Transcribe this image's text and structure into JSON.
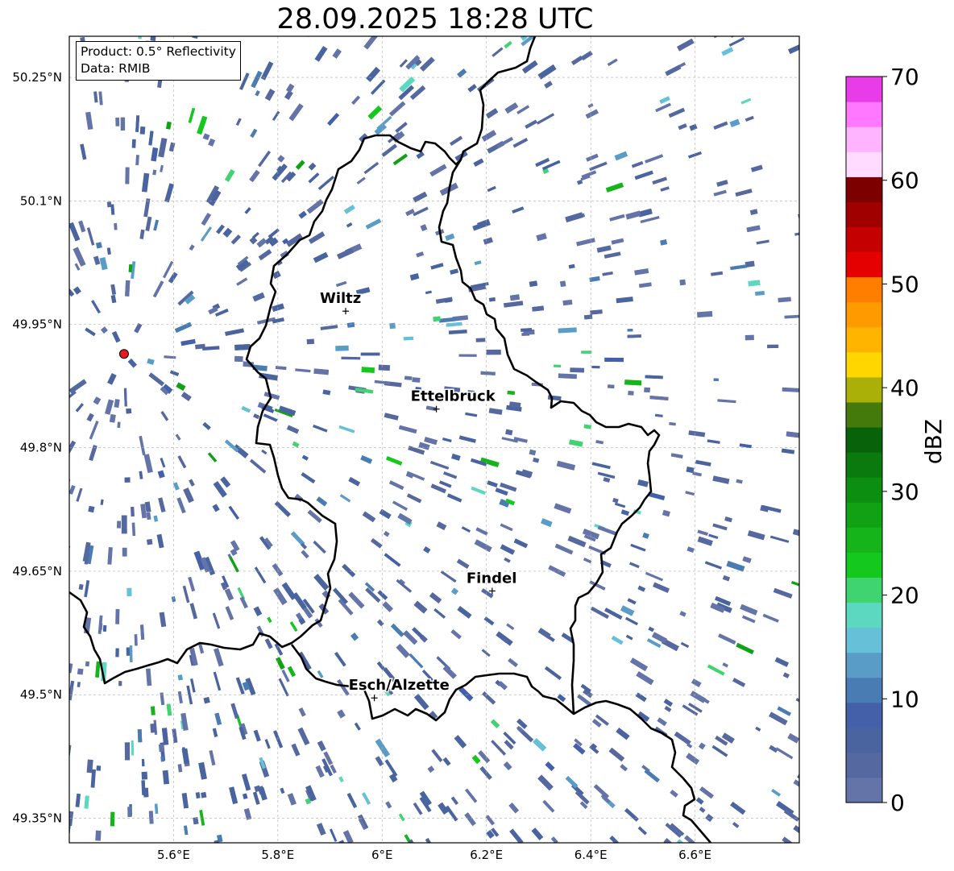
{
  "title": "28.09.2025 18:28 UTC",
  "info": {
    "product": "Product: 0.5° Reflectivity",
    "data": "Data: RMIB"
  },
  "axes": {
    "lon_range": [
      5.4,
      6.8
    ],
    "lat_range": [
      49.32,
      50.3
    ],
    "lon_ticks": [
      "5.6°E",
      "5.8°E",
      "6°E",
      "6.2°E",
      "6.4°E",
      "6.6°E"
    ],
    "lon_tick_values": [
      5.6,
      5.8,
      6.0,
      6.2,
      6.4,
      6.6
    ],
    "lat_ticks": [
      "50.25°N",
      "50.1°N",
      "49.95°N",
      "49.8°N",
      "49.65°N",
      "49.5°N",
      "49.35°N"
    ],
    "lat_tick_values": [
      50.25,
      50.1,
      49.95,
      49.8,
      49.65,
      49.5,
      49.35
    ],
    "grid": true
  },
  "radar_site": {
    "lon": 5.505,
    "lat": 49.914,
    "color": "#e41a1c"
  },
  "cities": [
    {
      "name": "Wiltz",
      "lon": 5.93,
      "lat": 49.966
    },
    {
      "name": "Ettelbruck",
      "lon": 6.104,
      "lat": 49.847
    },
    {
      "name": "Findel",
      "lon": 6.211,
      "lat": 49.626
    },
    {
      "name": "Esch/Alzette",
      "lon": 5.985,
      "lat": 49.496
    }
  ],
  "colorbar": {
    "label": "dBZ",
    "min": 0,
    "max": 70,
    "ticks": [
      "0",
      "10",
      "20",
      "30",
      "40",
      "50",
      "60",
      "70"
    ],
    "tick_values": [
      0,
      10,
      20,
      30,
      40,
      50,
      60,
      70
    ],
    "colors": [
      "#6474a8",
      "#5568a0",
      "#4a64a0",
      "#4460a8",
      "#4a7cb4",
      "#5a9cc8",
      "#66c0d8",
      "#5cd8c0",
      "#40d470",
      "#14c81e",
      "#14b41a",
      "#10a214",
      "#0c8e10",
      "#0a7a0e",
      "#08620a",
      "#447a0c",
      "#aab008",
      "#ffd600",
      "#ffb400",
      "#ff9a00",
      "#ff7e00",
      "#e40000",
      "#c40000",
      "#a00000",
      "#7c0000",
      "#ffdcff",
      "#ffb4ff",
      "#ff78ff",
      "#e83ce8"
    ]
  }
}
